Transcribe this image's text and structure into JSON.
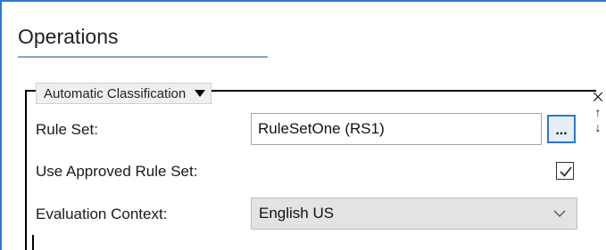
{
  "section": {
    "title": "Operations"
  },
  "group": {
    "dropdown_label": "Automatic Classification",
    "controls": {
      "close_glyph": "⨉",
      "up_glyph": "↑",
      "down_glyph": "↓"
    }
  },
  "form": {
    "rule_set": {
      "label": "Rule Set:",
      "value": "RuleSetOne (RS1)",
      "browse_label": "..."
    },
    "use_approved": {
      "label": "Use Approved Rule Set:",
      "checked": true
    },
    "evaluation_context": {
      "label": "Evaluation Context:",
      "selected": "English US"
    }
  },
  "colors": {
    "accent": "#2b78d4",
    "underline": "#8aa3bf",
    "select_bg": "#e3e3e3"
  }
}
